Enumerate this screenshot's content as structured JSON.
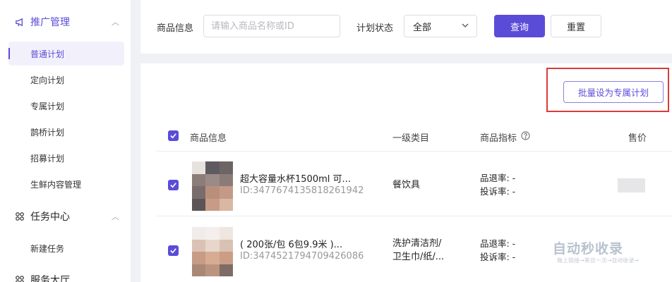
{
  "sidebar": {
    "groups": [
      {
        "label": "推广管理",
        "icon": "megaphone-icon"
      },
      {
        "label": "任务中心",
        "icon": "grid-icon"
      },
      {
        "label": "服务大厅",
        "icon": "grid-icon"
      }
    ],
    "items": [
      "普通计划",
      "定向计划",
      "专属计划",
      "鹊桥计划",
      "招募计划",
      "生鲜内容管理",
      "新建任务"
    ]
  },
  "filter": {
    "product_label": "商品信息",
    "product_placeholder": "请输入商品名称或ID",
    "status_label": "计划状态",
    "status_value": "全部",
    "query_label": "查询",
    "reset_label": "重置"
  },
  "table": {
    "batch_button": "批量设为专属计划",
    "headers": {
      "product": "商品信息",
      "category": "一级类目",
      "metrics": "商品指标",
      "price": "售价"
    },
    "rows": [
      {
        "name": "超大容量水杯1500ml 可...",
        "id": "ID:3477674135818261942",
        "category_lines": [
          "餐饮具"
        ],
        "return_rate": "品退率: -",
        "complaint_rate": "投诉率: -"
      },
      {
        "name": "( 200张/包 6包9.9米 )...",
        "id": "ID:3474521794709426086",
        "category_lines": [
          "洗护清洁剂/",
          "卫生巾/纸/..."
        ],
        "return_rate": "品退率: -",
        "complaint_rate": "投诉率: -"
      }
    ]
  },
  "watermark": {
    "logo": "自动秒收录",
    "subtitle": "做上链接→来访一次→自动收录→"
  },
  "colors": {
    "accent": "#5b4cd8",
    "highlight": "#d93a3a",
    "background": "#f0f1f5"
  }
}
